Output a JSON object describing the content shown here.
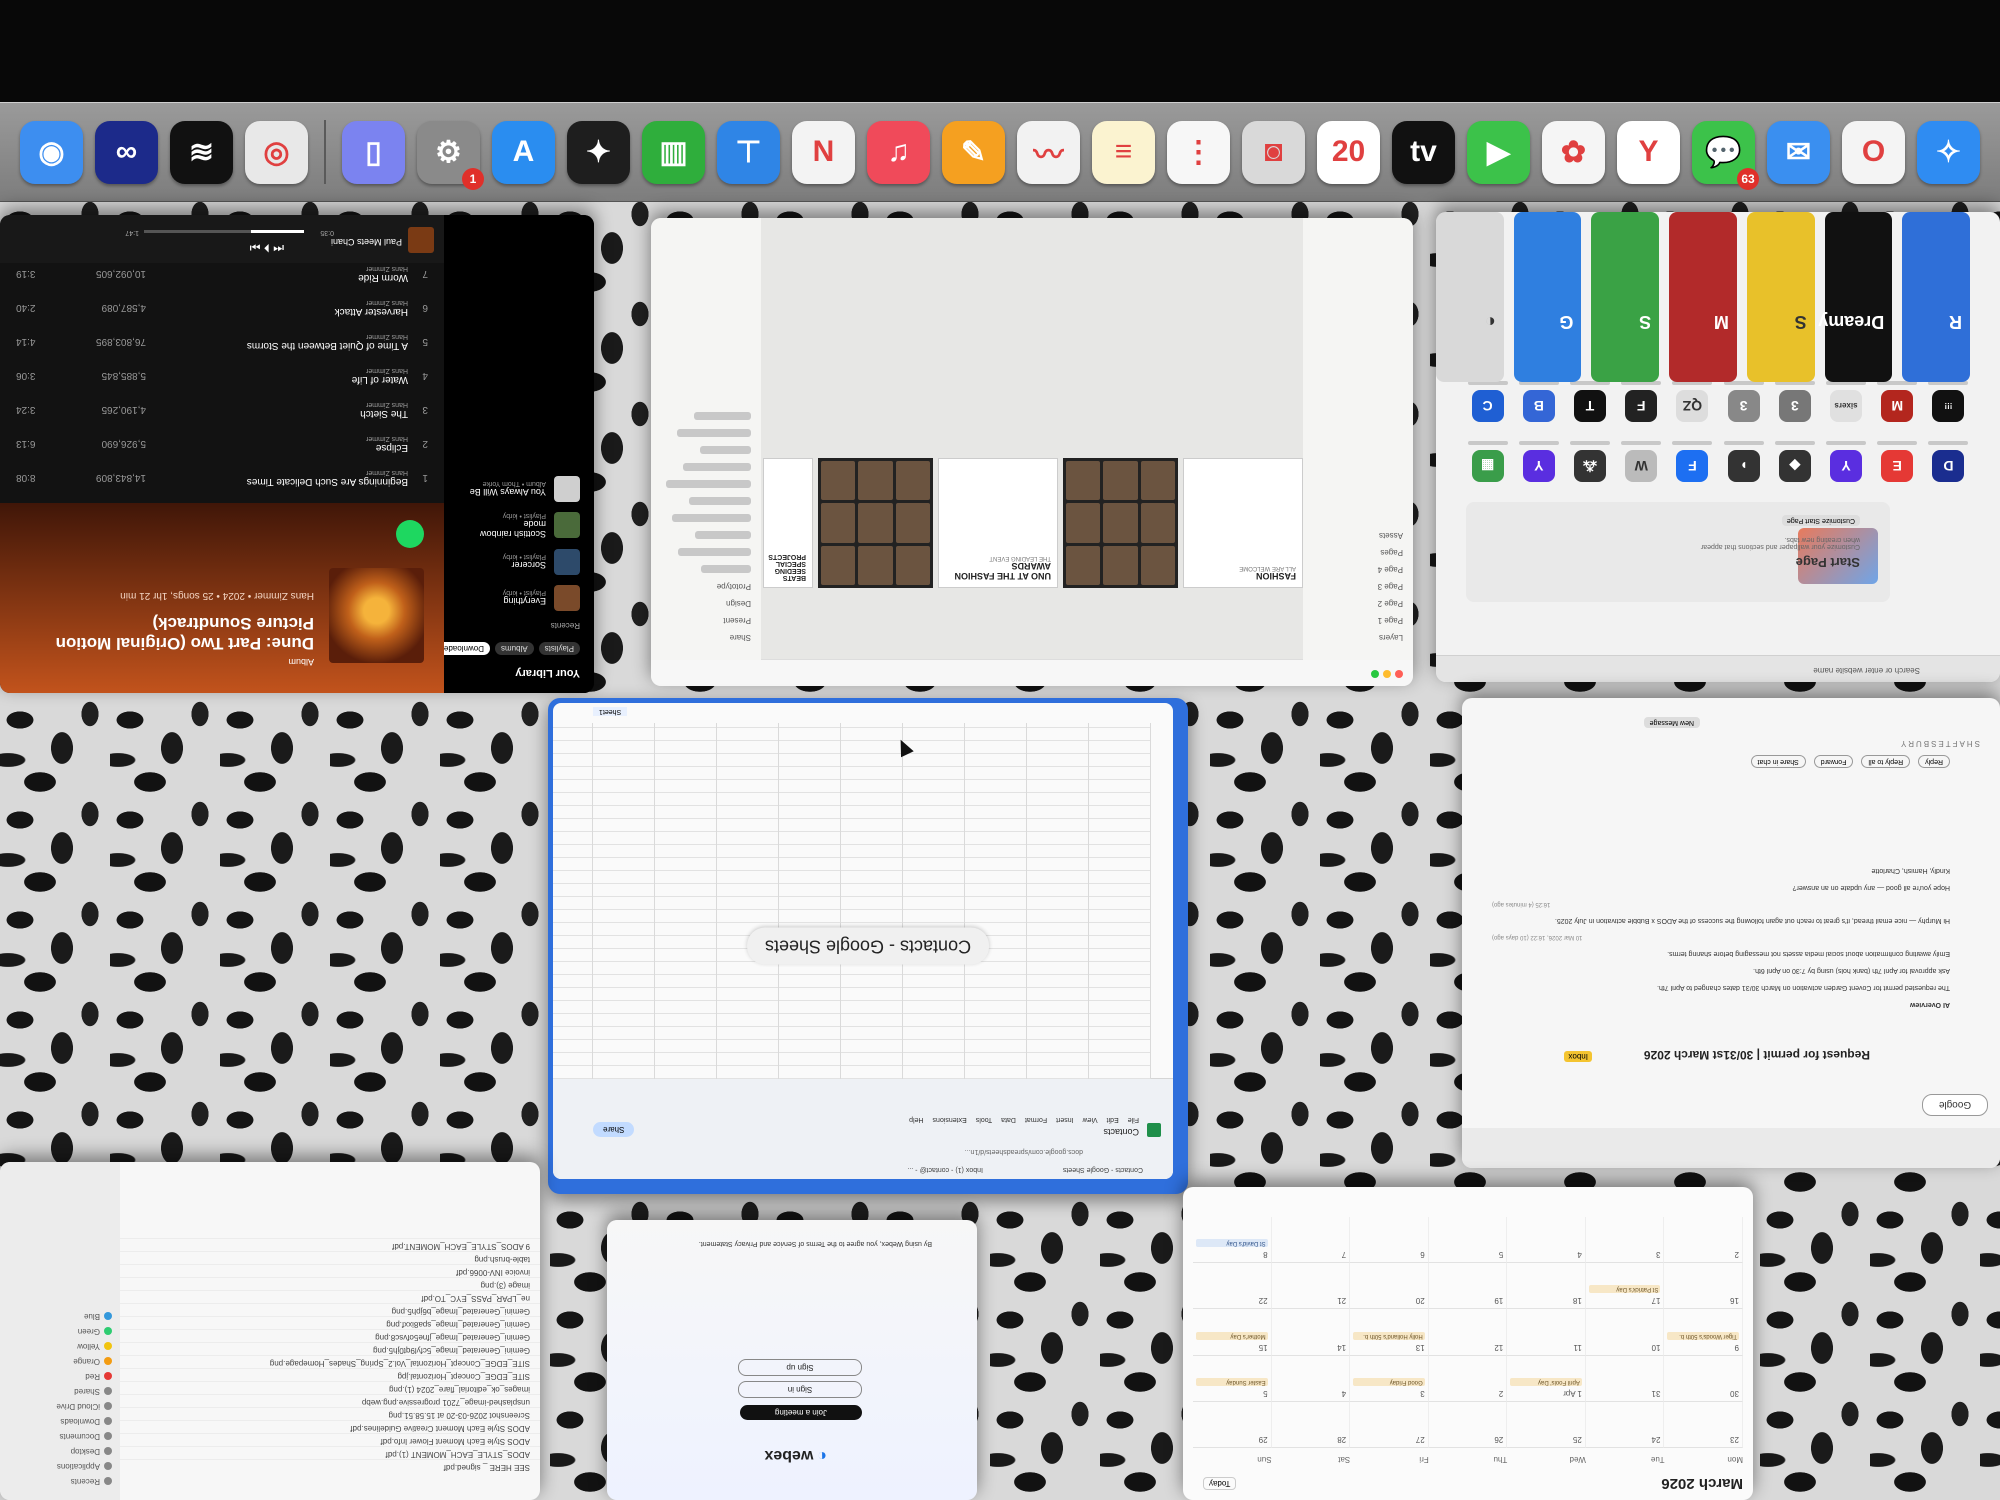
{
  "dock": {
    "items": [
      {
        "name": "Finder alt / Camera",
        "icon": "webcam-icon",
        "color": "#3d8ef0",
        "glyph": "◉"
      },
      {
        "name": "Meta",
        "icon": "meta-icon",
        "color": "#1c2a8a",
        "glyph": "∞"
      },
      {
        "name": "Spotify",
        "icon": "spotify-icon",
        "color": "#111111",
        "glyph": "≋"
      },
      {
        "name": "Chrome",
        "icon": "chrome-icon",
        "color": "#e8e8e8",
        "glyph": "◎"
      },
      {
        "name": "Simulator",
        "icon": "phone-icon",
        "color": "#7b83f0",
        "glyph": "▯"
      },
      {
        "name": "System Settings",
        "icon": "gear-icon",
        "color": "#8a8a8a",
        "glyph": "⚙",
        "badge": "1"
      },
      {
        "name": "App Store",
        "icon": "appstore-icon",
        "color": "#2a8df0",
        "glyph": "A"
      },
      {
        "name": "Figma",
        "icon": "figma-icon",
        "color": "#1e1e1e",
        "glyph": "✦"
      },
      {
        "name": "Numbers",
        "icon": "numbers-icon",
        "color": "#2fae3c",
        "glyph": "▥"
      },
      {
        "name": "Keynote",
        "icon": "keynote-icon",
        "color": "#2f85e6",
        "glyph": "⊤"
      },
      {
        "name": "News",
        "icon": "news-icon",
        "color": "#f3f3f3",
        "glyph": "N"
      },
      {
        "name": "Music",
        "icon": "music-icon",
        "color": "#f04a5a",
        "glyph": "♫"
      },
      {
        "name": "Pages",
        "icon": "pages-icon",
        "color": "#f5a020",
        "glyph": "✎"
      },
      {
        "name": "Freeform",
        "icon": "freeform-icon",
        "color": "#f2f2f2",
        "glyph": "〰"
      },
      {
        "name": "Notes",
        "icon": "notes-icon",
        "color": "#fbf3d0",
        "glyph": "≡"
      },
      {
        "name": "Reminders",
        "icon": "reminders-icon",
        "color": "#f7f7f7",
        "glyph": "⋮"
      },
      {
        "name": "Screenshot",
        "icon": "camera-icon",
        "color": "#d9d9d9",
        "glyph": "◙"
      },
      {
        "name": "Calendar",
        "icon": "calendar-icon",
        "color": "#ffffff",
        "glyph": "20",
        "label": "FRI"
      },
      {
        "name": "Apple TV",
        "icon": "tv-icon",
        "color": "#111111",
        "glyph": "tv"
      },
      {
        "name": "FaceTime",
        "icon": "facetime-icon",
        "color": "#3cc24a",
        "glyph": "▶"
      },
      {
        "name": "Photos",
        "icon": "photos-icon",
        "color": "#f5f5f5",
        "glyph": "✿"
      },
      {
        "name": "Yandex Maps",
        "icon": "map-pin-icon",
        "color": "#ffffff",
        "glyph": "Y"
      },
      {
        "name": "Messages",
        "icon": "messages-icon",
        "color": "#3cc24a",
        "glyph": "💬",
        "badge": "63"
      },
      {
        "name": "Mail",
        "icon": "mail-icon",
        "color": "#3a8ff0",
        "glyph": "✉"
      },
      {
        "name": "Opera",
        "icon": "opera-icon",
        "color": "#f4f4f4",
        "glyph": "O"
      },
      {
        "name": "Safari",
        "icon": "safari-icon",
        "color": "#2f8cf2",
        "glyph": "✧"
      }
    ]
  },
  "spotify": {
    "album_label": "Album",
    "album_title": "Dune: Part Two (Original Motion Picture Soundtrack)",
    "album_meta": "Hans Zimmer • 2024 • 25 songs, 1hr 21 min",
    "library_title": "Your Library",
    "create_label": "Create",
    "filters": [
      "Playlists",
      "Albums",
      "Downloaded"
    ],
    "recents_label": "Recents",
    "library_items": [
      {
        "title": "Everything",
        "sub": "Playlist • kirby",
        "color": "#7a4a2a"
      },
      {
        "title": "Sorcerer",
        "sub": "Playlist • kirby",
        "color": "#2d4a6a"
      },
      {
        "title": "Scottish rainbow mode",
        "sub": "Playlist • kirby",
        "color": "#4a6a3a"
      },
      {
        "title": "You Always Will Be",
        "sub": "Album • Thom Yorke",
        "color": "#cfcfcf"
      }
    ],
    "tracks": [
      {
        "n": "1",
        "title": "Beginnings Are Such Delicate Times",
        "artist": "Hans Zimmer",
        "plays": "14,843,809",
        "dur": "8:08"
      },
      {
        "n": "2",
        "title": "Eclipse",
        "artist": "Hans Zimmer",
        "plays": "5,926,690",
        "dur": "6:13"
      },
      {
        "n": "3",
        "title": "The Sietch",
        "artist": "Hans Zimmer",
        "plays": "4,190,265",
        "dur": "3:24"
      },
      {
        "n": "4",
        "title": "Water of Life",
        "artist": "Hans Zimmer",
        "plays": "5,885,845",
        "dur": "3:06"
      },
      {
        "n": "5",
        "title": "A Time of Quiet Between the Storms",
        "artist": "Hans Zimmer",
        "plays": "76,803,895",
        "dur": "4:14"
      },
      {
        "n": "6",
        "title": "Harvester Attack",
        "artist": "Hans Zimmer",
        "plays": "4,587,089",
        "dur": "2:40"
      },
      {
        "n": "7",
        "title": "Worm Ride",
        "artist": "Hans Zimmer",
        "plays": "10,092,605",
        "dur": "3:19"
      }
    ],
    "now_playing": "Paul Meets Chani",
    "time_elapsed": "0:35",
    "time_total": "1:47"
  },
  "design": {
    "pages": [
      {
        "title": "FASHION",
        "sub": "ALL ARE WELCOME"
      },
      {
        "title": "UNO AT THE FASHION AWARDS",
        "sub": "THE LEADING EVENT"
      },
      {
        "title": "BEATS SEEDING SPECIAL PROJECTS",
        "sub": "GIFTING AND SEEDING"
      }
    ],
    "left_panel": [
      "Layers",
      "Page 1",
      "Page 2",
      "Page 3",
      "Page 4",
      "Pages",
      "Assets"
    ],
    "right_panel": [
      "Share",
      "Present",
      "Design",
      "Prototype"
    ]
  },
  "safari": {
    "start_page_title": "Start Page",
    "customize_label": "Customize Start Page",
    "start_page_desc": "Customize your wallpaper and sections that appear when creating new tabs.",
    "search_placeholder": "Search or enter website name",
    "favorites": [
      {
        "g": "D",
        "c": "#1a2d8f"
      },
      {
        "g": "E",
        "c": "#e53935"
      },
      {
        "g": "Y",
        "c": "#5a2ee0"
      },
      {
        "g": "◆",
        "c": "#333333"
      },
      {
        "g": "◗",
        "c": "#333333"
      },
      {
        "g": "F",
        "c": "#1d6ff2"
      },
      {
        "g": "W",
        "c": "#bbbbbb"
      },
      {
        "g": "⁂",
        "c": "#333333"
      },
      {
        "g": "Y",
        "c": "#5a2ee0"
      },
      {
        "g": "▦",
        "c": "#3a9d4a"
      },
      {
        "g": "!!!",
        "c": "#111111"
      },
      {
        "g": "M",
        "c": "#b3261e"
      },
      {
        "g": "sixers",
        "c": "#e0e0e0"
      },
      {
        "g": "3",
        "c": "#777777"
      },
      {
        "g": "3",
        "c": "#888888"
      },
      {
        "g": "QZ",
        "c": "#dddddd"
      },
      {
        "g": "F",
        "c": "#222222"
      },
      {
        "g": "T",
        "c": "#111111"
      },
      {
        "g": "B",
        "c": "#3466d6"
      },
      {
        "g": "C",
        "c": "#1f5fd3"
      }
    ],
    "tiles": [
      {
        "c": "#2f6fd8",
        "label": "R"
      },
      {
        "c": "#111111",
        "label": "Dreamy"
      },
      {
        "c": "#e8c12a",
        "label": "S"
      },
      {
        "c": "#b22a2a",
        "label": "M"
      },
      {
        "c": "#3aa245",
        "label": "S"
      },
      {
        "c": "#2f7fe0",
        "label": "G"
      },
      {
        "c": "#d9d9d9",
        "label": "◐"
      }
    ]
  },
  "sheets": {
    "window_title": "Contacts - Google Sheets",
    "doc_title": "Contacts",
    "menu": [
      "File",
      "Edit",
      "View",
      "Insert",
      "Format",
      "Data",
      "Tools",
      "Extensions",
      "Help"
    ],
    "share_label": "Share",
    "sheet_tab": "Sheet1",
    "url": "docs.google.com/spreadsheets/d/1n...",
    "tab_label": "Contacts - Google Sheets",
    "tab_other": "Inbox (1) - contact@ - ..."
  },
  "mail": {
    "subject": "Request for permit | 30/31st March 2026",
    "tag": "Inbox",
    "new_message": "New Message",
    "google_label": "Google",
    "actions": [
      "Reply",
      "Reply to all",
      "Forward",
      "Share in chat"
    ],
    "body_lines": [
      "AI Overview",
      "The requested permit for Covent Garden activation on March 30/31 dates changed to April 7th.",
      "Ask approval for April 7th (bank hols) using by 7:30 on April 6th.",
      "Emily awaiting confirmation about social media assets not messaging before sharing terms.",
      "Hi Murphy — nice email thread, it's great to reach out again following the success of the ADOS x Bubble activation in July 2025.",
      "Hope you're all good — any update on an answer?",
      "Kindly, Hamish, Charlotte"
    ],
    "timestamps": [
      "10 Mar 2026, 16:22 (10 days ago)",
      "16:25 (4 minutes ago)",
      "16:27 (4 minutes ago)"
    ],
    "sender": "SHAFTESBURY"
  },
  "finder": {
    "sidebar": [
      {
        "label": "Recents",
        "c": "#888"
      },
      {
        "label": "Applications",
        "c": "#888"
      },
      {
        "label": "Desktop",
        "c": "#888"
      },
      {
        "label": "Documents",
        "c": "#888"
      },
      {
        "label": "Downloads",
        "c": "#888"
      },
      {
        "label": "iCloud Drive",
        "c": "#888"
      },
      {
        "label": "Shared",
        "c": "#888"
      },
      {
        "label": "Red",
        "c": "#e53935"
      },
      {
        "label": "Orange",
        "c": "#f39c12"
      },
      {
        "label": "Yellow",
        "c": "#f1c40f"
      },
      {
        "label": "Green",
        "c": "#2ecc71"
      },
      {
        "label": "Blue",
        "c": "#3498db"
      }
    ],
    "files": [
      "SEE HERE _ signed.pdf",
      "ADOS_STYLE_EACH_MOMENT (1).pdf",
      "ADOS Style Each Moment Flower Info.pdf",
      "ADOS Style Each Moment Creative Guidelines.pdf",
      "Screenshot 2026-03-20 at 15.58.51.png",
      "unsplashed-image_7201 progressive.png.webp",
      "images_ok_editorial_flare_2024 (1).png",
      "SITE_EDGE_Concept_Horizontal.jpg",
      "SITE_EDGE_Concept_Horizontal_Vol.2_Spring_Shades_Homepage.png",
      "Gemini_Generated_Image_5cfyl9qt0jh5.png",
      "Gemini_Generated_Image_jfne5ofvsc8.png",
      "Gemini_Generated_Image_spa8ixxf.png",
      "Gemini_Generated_Image_b6jph5.png",
      "ne_LPAR_PASS_EYC_TO.pdf",
      "image (3).png",
      "invoice INV-0066.pdf",
      "table-brush.png",
      "9 ADOS_STYLE_EACH_MOMENT.pdf"
    ]
  },
  "webex": {
    "brand": "webex",
    "join_label": "Join a meeting",
    "signin_label": "Sign in",
    "signup_label": "Sign up",
    "terms": "By using Webex, you agree to the Terms of Service and Privacy Statement."
  },
  "calendar": {
    "month": "March 2026",
    "today_label": "Today",
    "weekdays": [
      "Mon",
      "Tue",
      "Wed",
      "Thu",
      "Fri",
      "Sat",
      "Sun"
    ],
    "days": [
      {
        "d": "23"
      },
      {
        "d": "24"
      },
      {
        "d": "25"
      },
      {
        "d": "26"
      },
      {
        "d": "27"
      },
      {
        "d": "28"
      },
      {
        "d": "29"
      },
      {
        "d": "30"
      },
      {
        "d": "31"
      },
      {
        "d": "1 Apr",
        "e": "April Fools' Day"
      },
      {
        "d": "2"
      },
      {
        "d": "3",
        "e": "Good Friday"
      },
      {
        "d": "4"
      },
      {
        "d": "5",
        "e": "Easter Sunday"
      },
      {
        "d": "9",
        "e": "Tiger Woods's 50th b."
      },
      {
        "d": "10"
      },
      {
        "d": "11"
      },
      {
        "d": "12"
      },
      {
        "d": "13",
        "e": "Holly Holland's 50th b."
      },
      {
        "d": "14"
      },
      {
        "d": "15",
        "e": "Mother's Day"
      },
      {
        "d": "16"
      },
      {
        "d": "17",
        "e": "St Patrick's Day"
      },
      {
        "d": "18"
      },
      {
        "d": "19"
      },
      {
        "d": "20"
      },
      {
        "d": "21"
      },
      {
        "d": "22"
      },
      {
        "d": "2"
      },
      {
        "d": "3"
      },
      {
        "d": "4"
      },
      {
        "d": "5"
      },
      {
        "d": "6"
      },
      {
        "d": "7"
      },
      {
        "d": "8",
        "e": "St David's Day",
        "b": true
      }
    ]
  }
}
